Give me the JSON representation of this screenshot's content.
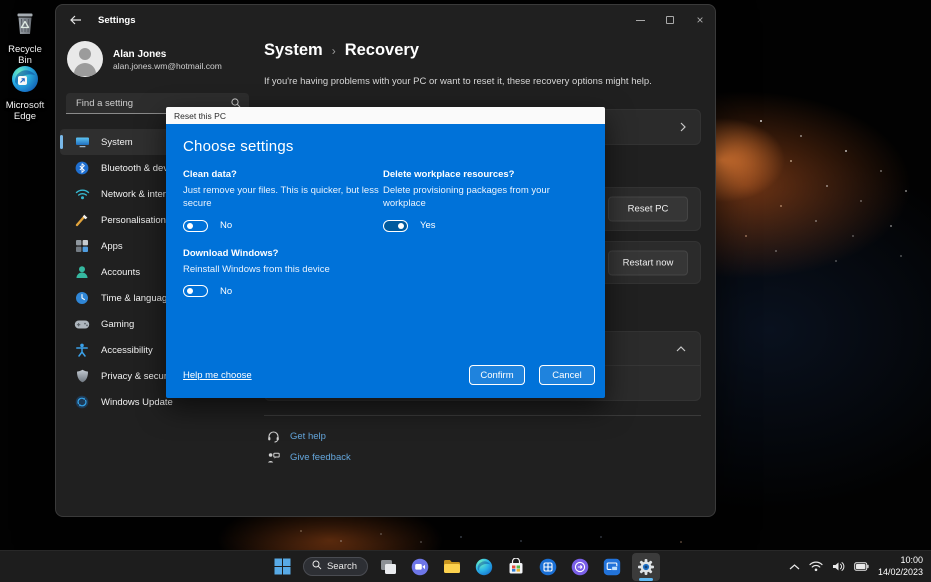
{
  "desktop": {
    "icons": [
      {
        "label": "Recycle Bin"
      },
      {
        "label": "Microsoft Edge"
      }
    ]
  },
  "window": {
    "title": "Settings",
    "profile": {
      "name": "Alan Jones",
      "email": "alan.jones.wm@hotmail.com"
    },
    "search_placeholder": "Find a setting",
    "nav": [
      {
        "label": "System",
        "selected": true
      },
      {
        "label": "Bluetooth & devices"
      },
      {
        "label": "Network & internet"
      },
      {
        "label": "Personalisation"
      },
      {
        "label": "Apps"
      },
      {
        "label": "Accounts"
      },
      {
        "label": "Time & language"
      },
      {
        "label": "Gaming"
      },
      {
        "label": "Accessibility"
      },
      {
        "label": "Privacy & security"
      },
      {
        "label": "Windows Update"
      }
    ],
    "page": {
      "breadcrumb_parent": "System",
      "breadcrumb_sep": "›",
      "breadcrumb_current": "Recovery",
      "description": "If you're having problems with your PC or want to reset it, these recovery options might help.",
      "reset_button": "Reset PC",
      "restart_button": "Restart now",
      "get_help": "Get help",
      "give_feedback": "Give feedback"
    },
    "controls": {
      "close_glyph": "×"
    }
  },
  "dialog": {
    "title": "Reset this PC",
    "heading": "Choose settings",
    "options": [
      {
        "label": "Clean data?",
        "description": "Just remove your files. This is quicker, but less secure",
        "state": "No",
        "on": false
      },
      {
        "label": "Delete workplace resources?",
        "description": "Delete provisioning packages from your workplace",
        "state": "Yes",
        "on": true
      },
      {
        "label": "Download Windows?",
        "description": "Reinstall Windows from this device",
        "state": "No",
        "on": false
      }
    ],
    "help_link": "Help me choose",
    "confirm_label": "Confirm",
    "cancel_label": "Cancel"
  },
  "taskbar": {
    "search_label": "Search",
    "clock": {
      "time": "10:00",
      "date": "14/02/2023"
    }
  },
  "colors": {
    "dialog_blue": "#0072d9",
    "toggle_on_fill": "#005a9e",
    "nav_accent": "#79b8e8",
    "taskbar_active_underline": "#5fb8f2",
    "link_blue": "#64a6dc",
    "wallpaper_bloom": "#c65a1e"
  },
  "icons": {
    "back": "left-arrow",
    "search": "magnifier",
    "chevron_right": "chevron",
    "chevron_up": "chevron",
    "minimize": "line",
    "maximize": "square",
    "close": "x",
    "tray": [
      "chevron-up",
      "wifi",
      "volume",
      "battery"
    ]
  }
}
